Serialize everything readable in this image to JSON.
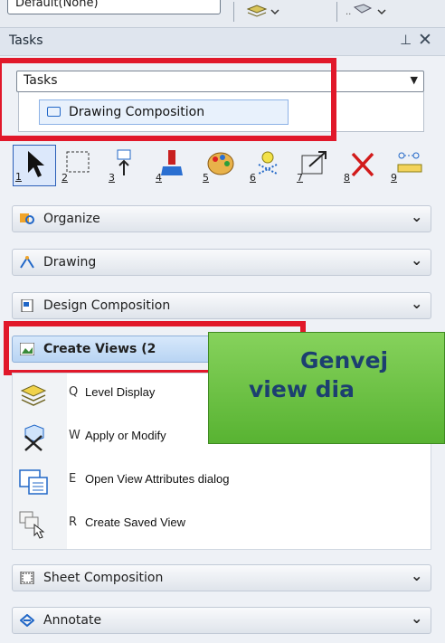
{
  "toolbar": {
    "combo_value": "Default(None)"
  },
  "panel": {
    "title": "Tasks",
    "pin_glyph": "📌",
    "close_glyph": "✕"
  },
  "tasks_combo": {
    "value": "Tasks",
    "open_item": "Drawing Composition"
  },
  "tools": [
    {
      "num": "1",
      "icon": "select-arrow-icon",
      "selected": true
    },
    {
      "num": "2",
      "icon": "selection-box-icon"
    },
    {
      "num": "3",
      "icon": "move-element-icon"
    },
    {
      "num": "4",
      "icon": "paint-brush-icon"
    },
    {
      "num": "5",
      "icon": "palette-icon"
    },
    {
      "num": "6",
      "icon": "highlight-icon"
    },
    {
      "num": "7",
      "icon": "scale-icon"
    },
    {
      "num": "8",
      "icon": "delete-icon"
    },
    {
      "num": "9",
      "icon": "measure-icon"
    }
  ],
  "sections": {
    "organize": "Organize",
    "drawing": "Drawing",
    "design_composition": "Design Composition",
    "create_views": "Create Views (2",
    "sheet_composition": "Sheet Composition",
    "annotate": "Annotate"
  },
  "create_views_items": [
    {
      "key": "Q",
      "label": "Level Display",
      "icon": "layers-icon"
    },
    {
      "key": "W",
      "label": "Apply or Modify",
      "icon": "view-cube-icon"
    },
    {
      "key": "E",
      "label": "Open View Attributes dialog",
      "icon": "view-attributes-icon"
    },
    {
      "key": "R",
      "label": "Create Saved View",
      "icon": "saved-view-icon"
    }
  ],
  "callout": {
    "line1": "Genvej",
    "line2": "view dia"
  },
  "colors": {
    "highlight_red": "#e1182a",
    "callout_green": "#6cc447",
    "callout_text": "#1c3f70",
    "active_section": "#c9defa"
  }
}
